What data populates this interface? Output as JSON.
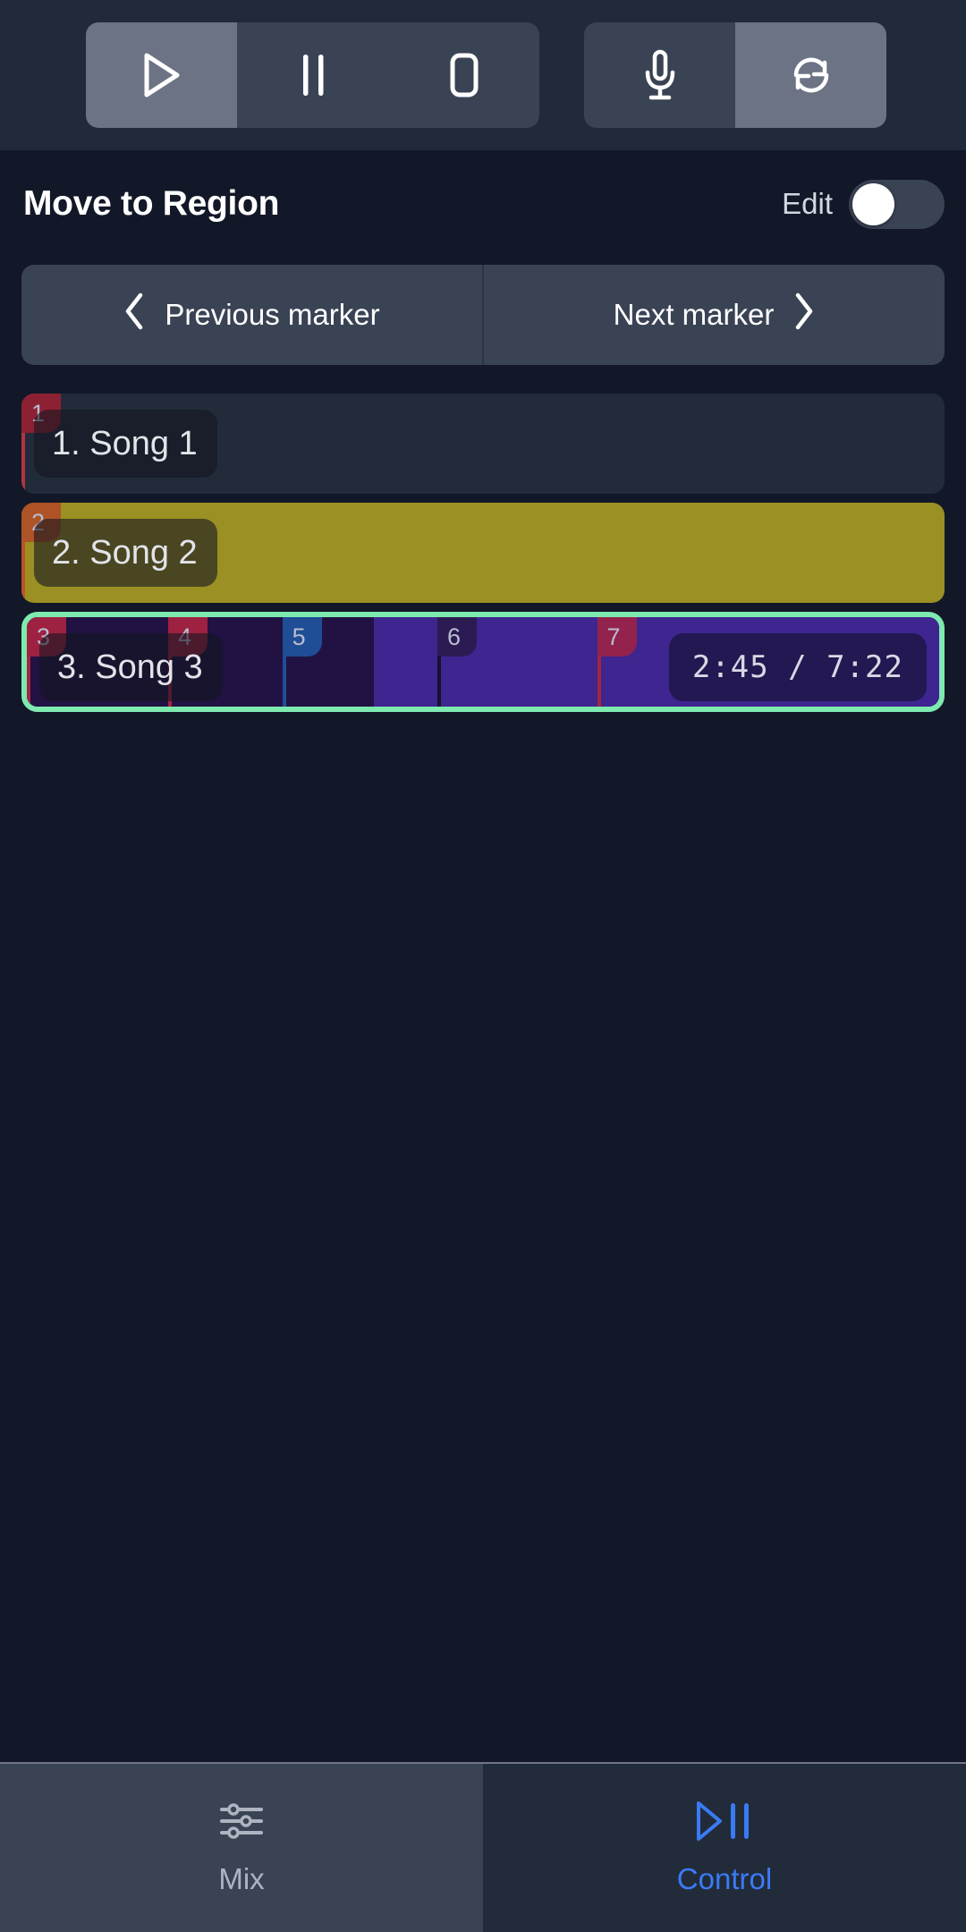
{
  "transport": {
    "groups": [
      {
        "name": "playback-group",
        "buttons": [
          {
            "name": "play-button",
            "icon": "play-icon",
            "active": true
          },
          {
            "name": "pause-button",
            "icon": "pause-icon",
            "active": false
          },
          {
            "name": "stop-button",
            "icon": "stop-icon",
            "active": false
          }
        ]
      },
      {
        "name": "record-loop-group",
        "buttons": [
          {
            "name": "record-button",
            "icon": "microphone-icon",
            "active": false
          },
          {
            "name": "loop-button",
            "icon": "refresh-icon",
            "active": true
          }
        ]
      }
    ]
  },
  "header": {
    "title": "Move to Region",
    "edit_label": "Edit",
    "edit_enabled": false
  },
  "marker_nav": {
    "previous_label": "Previous marker",
    "next_label": "Next marker"
  },
  "colors": {
    "page_background": "#121827",
    "transport_background": "#212a3a",
    "button_idle": "#3a4354",
    "button_active": "#6b7384",
    "selected_border": "#7eeab0",
    "accent_blue": "#3a7bf5",
    "marker_red": "#9e2141",
    "marker_orange": "#b4512a",
    "marker_blue": "#1f4d96",
    "marker_purple": "#2c1a52",
    "marker_magenta": "#93234d"
  },
  "regions": [
    {
      "name": "region-song-1",
      "label": "1. Song 1",
      "selected": false,
      "background": "#222b3a",
      "segments": [],
      "markers": [
        {
          "number": "1",
          "left_pct": 0.0,
          "badge_color": "#8c2133",
          "line_color": "#b1343f"
        }
      ]
    },
    {
      "name": "region-song-2",
      "label": "2. Song 2",
      "selected": false,
      "background": "#9a9024",
      "segments": [],
      "markers": [
        {
          "number": "2",
          "left_pct": 0.0,
          "badge_color": "#ae5326",
          "line_color": "#c0522a"
        }
      ]
    },
    {
      "name": "region-song-3",
      "label": "3. Song 3",
      "selected": true,
      "background": "#211243",
      "segments": [
        {
          "left_pct": 0.0,
          "width_pct": 38.0,
          "color": "#211243"
        },
        {
          "left_pct": 38.0,
          "width_pct": 62.0,
          "color": "#3e2590"
        }
      ],
      "markers": [
        {
          "number": "3",
          "left_pct": 0.0,
          "badge_color": "#9e2141",
          "line_color": "#a7243f"
        },
        {
          "number": "4",
          "left_pct": 15.5,
          "badge_color": "#9e2141",
          "line_color": "#a7243f"
        },
        {
          "number": "5",
          "left_pct": 28.0,
          "badge_color": "#1f4d96",
          "line_color": "#1f4d96"
        },
        {
          "number": "6",
          "left_pct": 45.0,
          "badge_color": "#2c1a52",
          "line_color": "#171030"
        },
        {
          "number": "7",
          "left_pct": 62.5,
          "badge_color": "#93234d",
          "line_color": "#a7243f"
        }
      ],
      "time_current": "2:45",
      "time_separator": "/",
      "time_total": "7:22",
      "time_display": "2:45  /  7:22"
    }
  ],
  "bottom_nav": {
    "tabs": [
      {
        "name": "nav-tab-mix",
        "label": "Mix",
        "icon": "sliders-icon",
        "active": false
      },
      {
        "name": "nav-tab-control",
        "label": "Control",
        "icon": "play-pause-icon",
        "active": true
      }
    ]
  }
}
